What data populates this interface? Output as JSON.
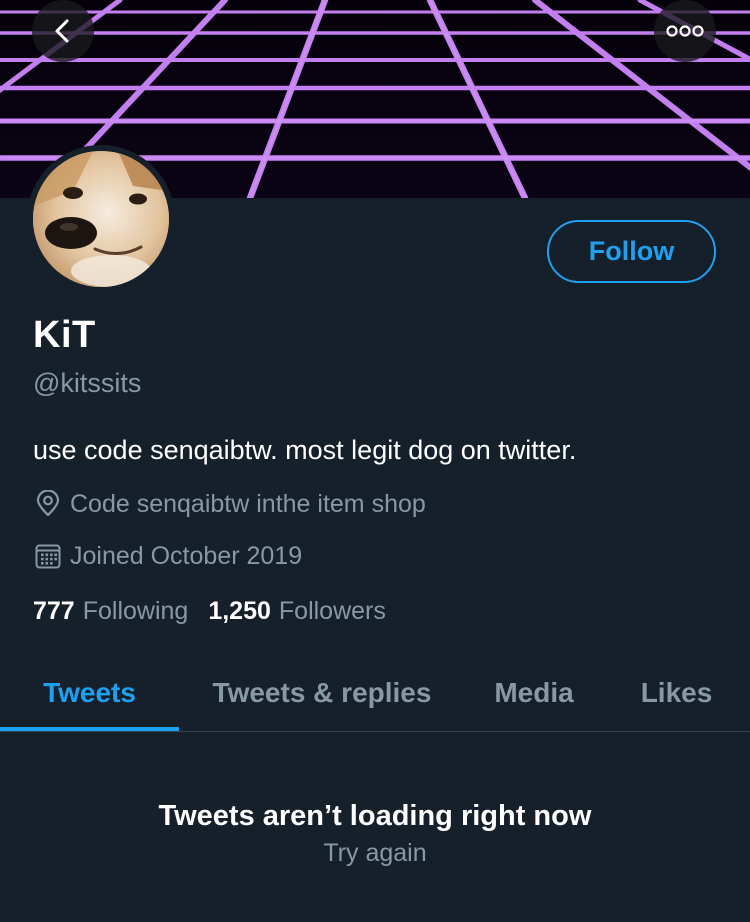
{
  "banner": {
    "description_icon": "synthwave-grid"
  },
  "nav": {
    "back_icon": "chevron-left-icon",
    "more_icon": "more-horizontal-icon"
  },
  "profile": {
    "display_name": "KiT",
    "handle": "@kitssits",
    "bio": "use code senqaibtw. most legit dog on twitter.",
    "location": "Code senqaibtw inthe item shop",
    "joined": "Joined October 2019",
    "follow_label": "Follow"
  },
  "stats": {
    "following_count": "777",
    "following_label": "Following",
    "followers_count": "1,250",
    "followers_label": "Followers"
  },
  "tabs": [
    {
      "label": "Tweets",
      "active": true
    },
    {
      "label": "Tweets & replies",
      "active": false
    },
    {
      "label": "Media",
      "active": false
    },
    {
      "label": "Likes",
      "active": false
    }
  ],
  "empty_state": {
    "title": "Tweets aren’t loading right now",
    "action": "Try again"
  },
  "colors": {
    "background": "#15202b",
    "accent": "#1da1f2",
    "secondary_text": "#8899a6",
    "grid": "#c77dff"
  }
}
